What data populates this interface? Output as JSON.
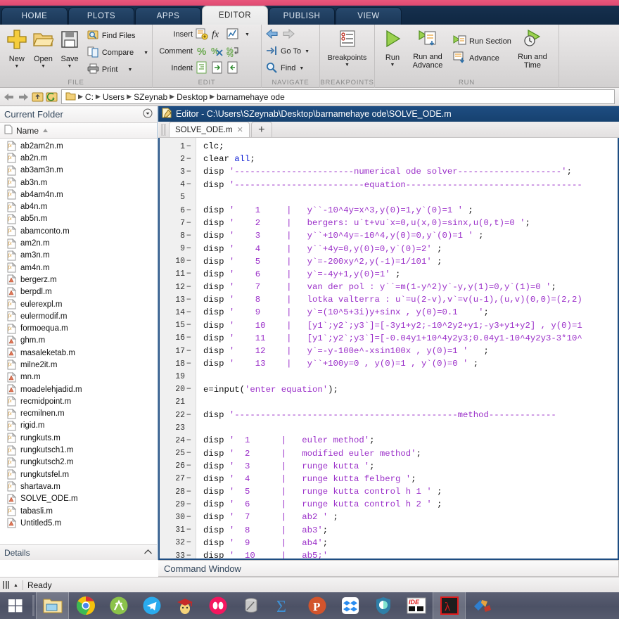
{
  "ribbon": {
    "tabs": [
      {
        "label": "HOME",
        "active": false
      },
      {
        "label": "PLOTS",
        "active": false
      },
      {
        "label": "APPS",
        "active": false
      },
      {
        "label": "EDITOR",
        "active": true
      },
      {
        "label": "PUBLISH",
        "active": false
      },
      {
        "label": "VIEW",
        "active": false
      }
    ],
    "groups": [
      {
        "title": "FILE",
        "big_buttons": [
          {
            "label": "New",
            "icon": "plus-icon",
            "has_caret": true
          },
          {
            "label": "Open",
            "icon": "folder-open-icon",
            "has_caret": true
          },
          {
            "label": "Save",
            "icon": "floppy-disk-icon",
            "has_caret": true
          }
        ],
        "small_buttons": [
          {
            "label": "Find Files",
            "icon": "find-files-icon",
            "has_caret": false
          },
          {
            "label": "Compare",
            "icon": "compare-icon",
            "has_caret": true
          },
          {
            "label": "Print",
            "icon": "printer-icon",
            "has_caret": true
          }
        ]
      },
      {
        "title": "EDIT",
        "rows": [
          {
            "label": "Insert",
            "icons": [
              "insert-block-icon",
              "fx-function-icon",
              "figure-insert-icon"
            ],
            "has_caret": true
          },
          {
            "label": "Comment",
            "icons": [
              "comment-percent-icon",
              "uncomment-icon",
              "wrap-comment-icon"
            ],
            "has_caret": false
          },
          {
            "label": "Indent",
            "icons": [
              "smart-indent-icon",
              "indent-right-icon",
              "indent-left-icon"
            ],
            "has_caret": false
          }
        ]
      },
      {
        "title": "NAVIGATE",
        "small_buttons": [
          {
            "label": "",
            "icon": "back-arrow-icon",
            "has_caret": false
          },
          {
            "label": "Go To",
            "icon": "goto-icon",
            "has_caret": true
          },
          {
            "label": "Find",
            "icon": "search-icon",
            "has_caret": true
          }
        ]
      },
      {
        "title": "BREAKPOINTS",
        "big_buttons": [
          {
            "label": "Breakpoints",
            "icon": "breakpoints-icon",
            "has_caret": true
          }
        ]
      },
      {
        "title": "RUN",
        "big_buttons": [
          {
            "label": "Run",
            "icon": "run-play-icon",
            "has_caret": true
          },
          {
            "label": "Run and\nAdvance",
            "icon": "run-advance-icon",
            "has_caret": false
          },
          {
            "label": "Run and\nTime",
            "icon": "run-time-icon",
            "has_caret": false
          }
        ],
        "small_buttons": [
          {
            "label": "Run Section",
            "icon": "run-section-icon",
            "has_caret": false
          },
          {
            "label": "Advance",
            "icon": "advance-icon",
            "has_caret": false
          }
        ]
      }
    ]
  },
  "address_bar": {
    "back_icon": "back-arrow-icon",
    "forward_icon": "forward-arrow-icon",
    "up_icon": "up-folder-icon",
    "refresh_icon": "browse-folder-icon",
    "folder_icon": "folder-icon",
    "crumbs": [
      "C:",
      "Users",
      "SZeynab",
      "Desktop",
      "barnamehaye ode"
    ]
  },
  "current_folder": {
    "title": "Current Folder",
    "collapse_icon": "chevron-down-circle-icon",
    "column_header": "Name",
    "sort_icon": "sort-ascending-icon",
    "details_label": "Details",
    "details_icon": "chevron-up-icon",
    "files": [
      {
        "name": "ab2am2n.m",
        "type": "fx"
      },
      {
        "name": "ab2n.m",
        "type": "fx"
      },
      {
        "name": "ab3am3n.m",
        "type": "fx"
      },
      {
        "name": "ab3n.m",
        "type": "fx"
      },
      {
        "name": "ab4am4n.m",
        "type": "fx"
      },
      {
        "name": "ab4n.m",
        "type": "fx"
      },
      {
        "name": "ab5n.m",
        "type": "fx"
      },
      {
        "name": "abamconto.m",
        "type": "fx"
      },
      {
        "name": "am2n.m",
        "type": "fx"
      },
      {
        "name": "am3n.m",
        "type": "fx"
      },
      {
        "name": "am4n.m",
        "type": "fx"
      },
      {
        "name": "bergerz.m",
        "type": "script"
      },
      {
        "name": "berpdl.m",
        "type": "script"
      },
      {
        "name": "eulerexpl.m",
        "type": "fx"
      },
      {
        "name": "eulermodif.m",
        "type": "fx"
      },
      {
        "name": "formoequa.m",
        "type": "fx"
      },
      {
        "name": "ghm.m",
        "type": "script"
      },
      {
        "name": "masaleketab.m",
        "type": "script"
      },
      {
        "name": "milne2it.m",
        "type": "fx"
      },
      {
        "name": "mn.m",
        "type": "script"
      },
      {
        "name": "moadelehjadid.m",
        "type": "script"
      },
      {
        "name": "recmidpoint.m",
        "type": "fx"
      },
      {
        "name": "recmilnen.m",
        "type": "fx"
      },
      {
        "name": "rigid.m",
        "type": "fx"
      },
      {
        "name": "rungkuts.m",
        "type": "fx"
      },
      {
        "name": "rungkutsch1.m",
        "type": "fx"
      },
      {
        "name": "rungkutsch2.m",
        "type": "fx"
      },
      {
        "name": "rungkutsfel.m",
        "type": "fx"
      },
      {
        "name": "shartava.m",
        "type": "fx"
      },
      {
        "name": "SOLVE_ODE.m",
        "type": "script"
      },
      {
        "name": "tabasli.m",
        "type": "fx"
      },
      {
        "name": "Untitled5.m",
        "type": "script"
      }
    ]
  },
  "editor": {
    "title": "Editor - C:\\Users\\SZeynab\\Desktop\\barnamehaye ode\\SOLVE_ODE.m",
    "title_icon": "editor-document-icon",
    "tab_label": "SOLVE_ODE.m",
    "tab_close_icon": "close-icon",
    "new_tab_icon": "plus-icon",
    "lines": [
      {
        "n": 1,
        "bp": true,
        "text": "clc;"
      },
      {
        "n": 2,
        "bp": true,
        "text": "clear all;"
      },
      {
        "n": 3,
        "bp": true,
        "text": "disp '-----------------------numerical ode solver--------------------';"
      },
      {
        "n": 4,
        "bp": true,
        "text": "disp '-------------------------equation----------------------------------"
      },
      {
        "n": 5,
        "bp": false,
        "text": ""
      },
      {
        "n": 6,
        "bp": true,
        "text": "disp '    1     |   y``-10^4y=x^3,y(0)=1,y`(0)=1 ' ;"
      },
      {
        "n": 7,
        "bp": true,
        "text": "disp '    2     |   bergers: u`t+vu`x=0,u(x,0)=sinx,u(0,t)=0 ';"
      },
      {
        "n": 8,
        "bp": true,
        "text": "disp '    3     |   y``+10^4y=-10^4,y(0)=0,y`(0)=1 ' ;"
      },
      {
        "n": 9,
        "bp": true,
        "text": "disp '    4     |   y``+4y=0,y(0)=0,y`(0)=2' ;"
      },
      {
        "n": 10,
        "bp": true,
        "text": "disp '    5     |   y`=-200xy^2,y(-1)=1/101' ;"
      },
      {
        "n": 11,
        "bp": true,
        "text": "disp '    6     |   y`=-4y+1,y(0)=1' ;"
      },
      {
        "n": 12,
        "bp": true,
        "text": "disp '    7     |   van der pol : y``=m(1-y^2)y`-y,y(1)=0,y`(1)=0 ';"
      },
      {
        "n": 13,
        "bp": true,
        "text": "disp '    8     |   lotka valterra : u`=u(2-v),v`=v(u-1),(u,v)(0,0)=(2,2)"
      },
      {
        "n": 14,
        "bp": true,
        "text": "disp '    9     |   y`=(10^5+3i)y+sinx , y(0)=0.1    ';"
      },
      {
        "n": 15,
        "bp": true,
        "text": "disp '    10    |   [y1`;y2`;y3`]=[-3y1+y2;-10^2y2+y1;-y3+y1+y2] , y(0)=1"
      },
      {
        "n": 16,
        "bp": true,
        "text": "disp '    11    |   [y1`;y2`;y3`]=[-0.04y1+10^4y2y3;0.04y1-10^4y2y3-3*10^"
      },
      {
        "n": 17,
        "bp": true,
        "text": "disp '    12    |   y`=-y-100e^-xsin100x , y(0)=1 '   ;"
      },
      {
        "n": 18,
        "bp": true,
        "text": "disp '    13    |   y``+100y=0 , y(0)=1 , y`(0)=0 ' ;"
      },
      {
        "n": 19,
        "bp": false,
        "text": ""
      },
      {
        "n": 20,
        "bp": true,
        "text": "e=input('enter equation');"
      },
      {
        "n": 21,
        "bp": false,
        "text": ""
      },
      {
        "n": 22,
        "bp": true,
        "text": "disp '-------------------------------------------method-------------"
      },
      {
        "n": 23,
        "bp": false,
        "text": ""
      },
      {
        "n": 24,
        "bp": true,
        "text": "disp '  1      |   euler method';"
      },
      {
        "n": 25,
        "bp": true,
        "text": "disp '  2      |   modified euler method';"
      },
      {
        "n": 26,
        "bp": true,
        "text": "disp '  3      |   runge kutta ';"
      },
      {
        "n": 27,
        "bp": true,
        "text": "disp '  4      |   runge kutta felberg ';"
      },
      {
        "n": 28,
        "bp": true,
        "text": "disp '  5      |   runge kutta control h 1 ' ;"
      },
      {
        "n": 29,
        "bp": true,
        "text": "disp '  6      |   runge kutta control h 2 ' ;"
      },
      {
        "n": 30,
        "bp": true,
        "text": "disp '  7      |   ab2 ' ;"
      },
      {
        "n": 31,
        "bp": true,
        "text": "disp '  8      |   ab3';"
      },
      {
        "n": 32,
        "bp": true,
        "text": "disp '  9      |   ab4';"
      },
      {
        "n": 33,
        "bp": true,
        "text": "disp '  10     |   ab5;'"
      }
    ]
  },
  "command_window": {
    "title": "Command Window"
  },
  "status_bar": {
    "busy_icon": "busy-indicator-icon",
    "text": "Ready"
  },
  "taskbar": {
    "start_icon": "windows-start-icon",
    "items": [
      {
        "icon": "file-explorer-icon",
        "selected": true
      },
      {
        "icon": "google-chrome-icon",
        "selected": false
      },
      {
        "icon": "android-studio-icon",
        "selected": false
      },
      {
        "icon": "telegram-icon",
        "selected": false
      },
      {
        "icon": "graduate-icon",
        "selected": false
      },
      {
        "icon": "opera-icon",
        "selected": false
      },
      {
        "icon": "database-icon",
        "selected": false
      },
      {
        "icon": "matlab-sigma-icon",
        "selected": false
      },
      {
        "icon": "proxy-p-icon",
        "selected": false
      },
      {
        "icon": "dropbox-icon",
        "selected": false
      },
      {
        "icon": "hotspot-shield-icon",
        "selected": false
      },
      {
        "icon": "ide-icon",
        "selected": false
      },
      {
        "icon": "adobe-acrobat-icon",
        "selected": true
      },
      {
        "icon": "colorful-app-icon",
        "selected": false
      }
    ]
  },
  "colors": {
    "ribbon_tabbar": "#16304e",
    "accent_pink": "#e8567c",
    "editor_title_blue": "#1e4d82",
    "string_purple": "#9b30c9",
    "keyword_blue": "#0f1fd4"
  }
}
